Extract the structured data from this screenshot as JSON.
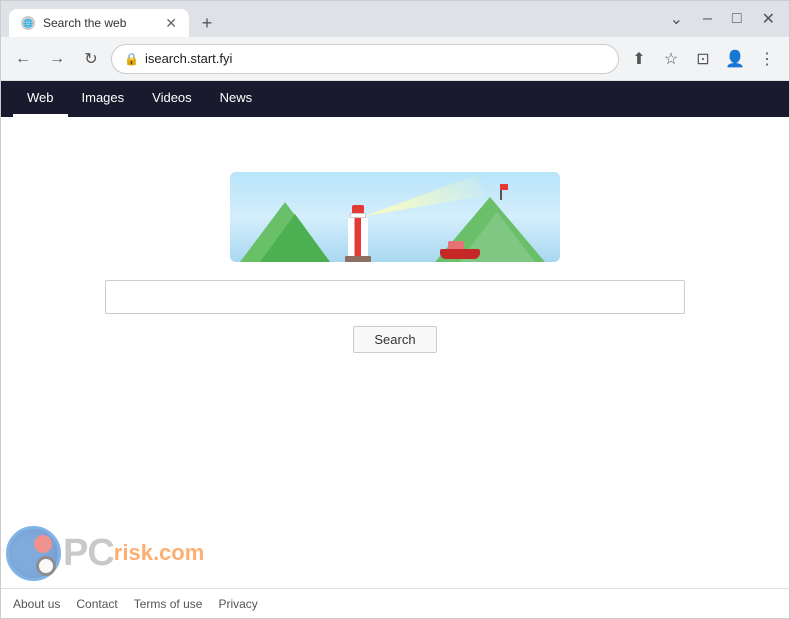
{
  "browser": {
    "tab": {
      "title": "Search the web",
      "favicon": "🌐"
    },
    "new_tab_label": "+",
    "window_controls": {
      "chevron_down": "⌄",
      "minimize": "–",
      "maximize": "□",
      "close": "✕"
    },
    "toolbar": {
      "back": "←",
      "forward": "→",
      "reload": "↻",
      "url": "isearch.start.fyi",
      "share_icon": "⬆",
      "star_icon": "☆",
      "reading_icon": "⊡",
      "profile_icon": "👤",
      "menu_icon": "⋮"
    }
  },
  "site_nav": {
    "items": [
      {
        "label": "Web",
        "active": true
      },
      {
        "label": "Images",
        "active": false
      },
      {
        "label": "Videos",
        "active": false
      },
      {
        "label": "News",
        "active": false
      }
    ]
  },
  "search": {
    "placeholder": "",
    "button_label": "Search"
  },
  "footer": {
    "links": [
      {
        "label": "About us"
      },
      {
        "label": "Contact"
      },
      {
        "label": "Terms of use"
      },
      {
        "label": "Privacy"
      }
    ]
  },
  "watermark": {
    "text": "PC",
    "domain": "risk.com"
  }
}
